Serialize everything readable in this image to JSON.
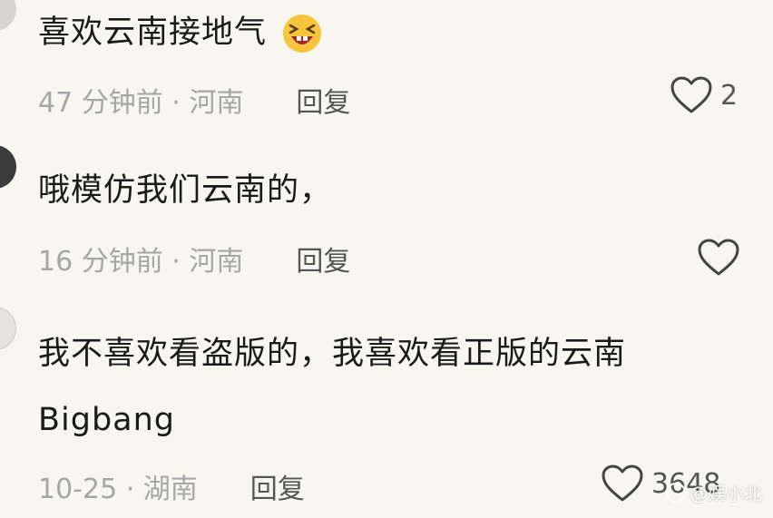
{
  "comments": [
    {
      "text": "喜欢云南接地气",
      "emoji": "laughing-squint-emoji",
      "time": "47 分钟前 · 河南",
      "reply": "回复",
      "likes": "2"
    },
    {
      "text": "哦模仿我们云南的，",
      "time": "16 分钟前 · 河南",
      "reply": "回复",
      "likes": ""
    },
    {
      "text_line1": "我不喜欢看盗版的，我喜欢看正版的云南",
      "text_line2": "Bigbang",
      "time": "10-25 · 湖南",
      "reply": "回复",
      "likes": "3648"
    }
  ],
  "watermark": "@娱小北",
  "icons": {
    "like": "heart-outline-icon"
  },
  "colors": {
    "background": "#f8f6f1",
    "text": "#1a1a1a",
    "meta": "#a6a6a6",
    "reply": "#555555"
  }
}
